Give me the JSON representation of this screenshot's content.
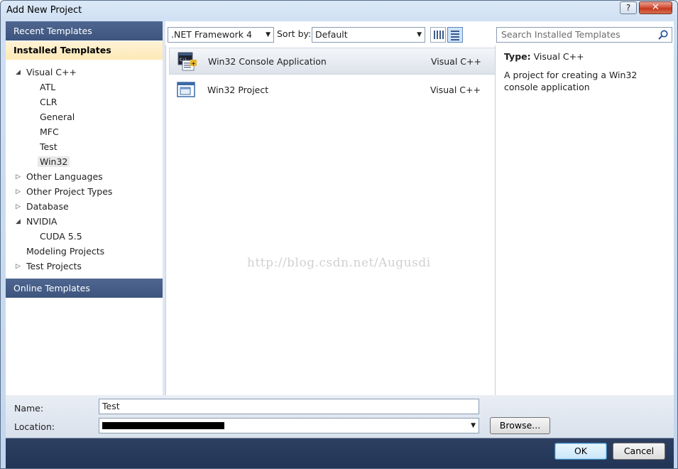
{
  "window": {
    "title": "Add New Project",
    "help_glyph": "?",
    "close_glyph": "✕"
  },
  "sidebar": {
    "recent": "Recent Templates",
    "installed": "Installed Templates",
    "online": "Online Templates",
    "tree": [
      {
        "label": "Visual C++",
        "arrow": "◢"
      },
      {
        "label": "ATL"
      },
      {
        "label": "CLR"
      },
      {
        "label": "General"
      },
      {
        "label": "MFC"
      },
      {
        "label": "Test"
      },
      {
        "label": "Win32"
      },
      {
        "label": "Other Languages",
        "arrow": "▷"
      },
      {
        "label": "Other Project Types",
        "arrow": "▷"
      },
      {
        "label": "Database",
        "arrow": "▷"
      },
      {
        "label": "NVIDIA",
        "arrow": "◢"
      },
      {
        "label": "CUDA 5.5"
      },
      {
        "label": "Modeling Projects"
      },
      {
        "label": "Test Projects",
        "arrow": "▷"
      }
    ]
  },
  "toolbar": {
    "framework": ".NET Framework 4",
    "sort_label": "Sort by:",
    "sort_value": "Default",
    "search_placeholder": "Search Installed Templates"
  },
  "templates": [
    {
      "name": "Win32 Console Application",
      "lang": "Visual C++"
    },
    {
      "name": "Win32 Project",
      "lang": "Visual C++"
    }
  ],
  "description": {
    "type_label": "Type:",
    "type_value": "Visual C++",
    "text": "A project for creating a Win32 console application"
  },
  "form": {
    "name_label": "Name:",
    "name_value": "Test",
    "location_label": "Location:",
    "browse": "Browse...",
    "ok": "OK",
    "cancel": "Cancel"
  },
  "watermark": "http://blog.csdn.net/Augusdi",
  "colors": {
    "sidebar_header": "#445d88",
    "selected_bg": "#fde9b6",
    "footer": "#223556"
  }
}
